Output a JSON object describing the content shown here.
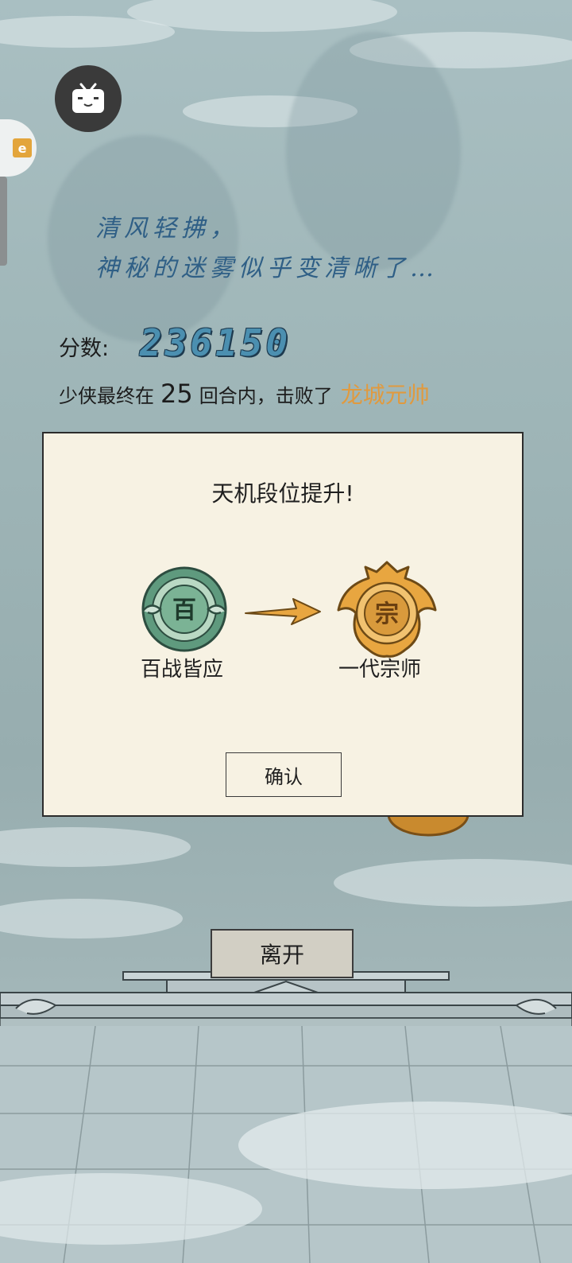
{
  "poem": {
    "line1": "清风轻拂，",
    "line2": "神秘的迷雾似乎变清晰了…"
  },
  "score": {
    "label": "分数:",
    "value": "236150"
  },
  "result": {
    "prefix": "少侠最终在",
    "rounds": "25",
    "suffix": "回合内，击败了",
    "boss": "龙城元帅"
  },
  "dialog": {
    "title": "天机段位提升!",
    "old_rank": {
      "badge_char": "百",
      "name": "百战皆应",
      "color": "#5f9a7e"
    },
    "new_rank": {
      "badge_char": "宗",
      "name": "一代宗师",
      "color": "#e8a640"
    },
    "confirm_label": "确认"
  },
  "leave_label": "离开",
  "side_badge": {
    "label": "e"
  },
  "colors": {
    "boss_name": "#e09a3f",
    "score": "#4b8fb0",
    "poem": "#2f5f86",
    "dialog_bg": "#f7f2e3"
  }
}
